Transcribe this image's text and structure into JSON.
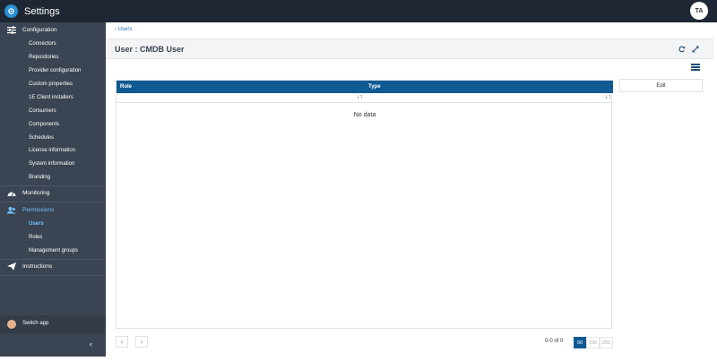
{
  "app": {
    "title": "Settings",
    "avatar_initials": "TA"
  },
  "sidebar": {
    "configuration": {
      "label": "Configuration",
      "items": [
        "Connectors",
        "Repositories",
        "Provider configuration",
        "Custom properties",
        "1E Client installers",
        "Consumers",
        "Components",
        "Schedules",
        "License information",
        "System information",
        "Branding"
      ]
    },
    "monitoring": {
      "label": "Monitoring"
    },
    "permissions": {
      "label": "Permissions",
      "items": [
        "Users",
        "Roles",
        "Management groups"
      ],
      "active_item": "Users"
    },
    "instructions": {
      "label": "Instructions"
    },
    "switch_app": {
      "label": "Switch app"
    }
  },
  "main": {
    "breadcrumb": "Users",
    "title": "User : CMDB User",
    "table": {
      "columns": [
        "Role",
        "Type"
      ],
      "empty_text": "No data"
    },
    "edit_label": "Edit",
    "pagination": {
      "range": "0-0 of 0",
      "page_sizes": [
        "50",
        "100",
        "250"
      ],
      "selected_page_size": "50"
    }
  },
  "colors": {
    "topbar": "#1e2733",
    "sidebar": "#3a4452",
    "accent": "#0f5a93",
    "active_nav": "#6ec3ff"
  }
}
